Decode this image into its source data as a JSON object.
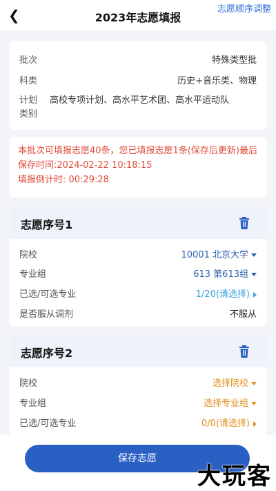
{
  "header": {
    "title": "2023年志愿填报",
    "right_link": "志愿顺序调整"
  },
  "info": {
    "batch_label": "批次",
    "batch_value": "特殊类型批",
    "subject_label": "科类",
    "subject_value": "历史+音乐类、物理",
    "plan_label": "计划类别",
    "plan_value": "高校专项计划、高水平艺术团、高水平运动队"
  },
  "notice": {
    "text": "本批次可填报志愿40条，您已填报志愿1条(保存后更新)最后保存时间:2024-02-22 10:18:15",
    "countdown": "填报倒计时: 00:29:28"
  },
  "choices": [
    {
      "title": "志愿序号1",
      "school_label": "院校",
      "school_value": "10001 北京大学",
      "group_label": "专业组",
      "group_value": "613 第613组",
      "major_label": "已选/可选专业",
      "major_value": "1/20(请选择)",
      "adjust_label": "是否服从调剂",
      "adjust_value": "不服从"
    },
    {
      "title": "志愿序号2",
      "school_label": "院校",
      "school_value": "选择院校",
      "group_label": "专业组",
      "group_value": "选择专业组",
      "major_label": "已选/可选专业",
      "major_value": "0/0(请选择)"
    }
  ],
  "footer": {
    "save_label": "保存志愿"
  },
  "watermark": "大玩客",
  "colors": {
    "primary": "#2a5fc4",
    "notice_red": "#e04a3a",
    "placeholder_orange": "#e09020",
    "link_blue": "#2f6fd9"
  }
}
